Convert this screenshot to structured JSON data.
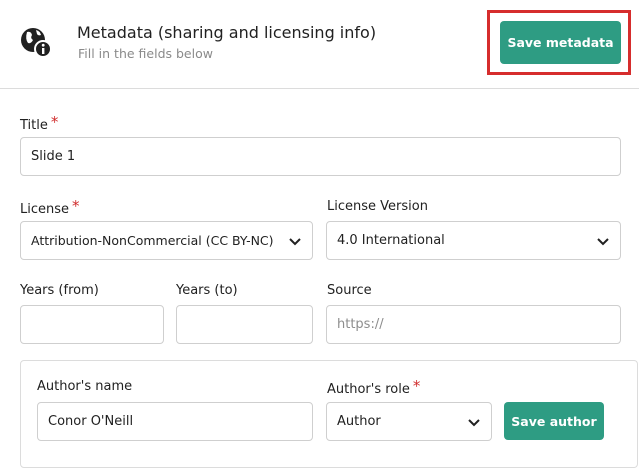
{
  "header": {
    "title": "Metadata (sharing and licensing info)",
    "subtitle": "Fill in the fields below",
    "icon": "globe-info-icon",
    "save_label": "Save metadata"
  },
  "form": {
    "title": {
      "label": "Title",
      "required_mark": "*",
      "value": "Slide 1"
    },
    "license": {
      "label": "License",
      "required_mark": "*",
      "value": "Attribution-NonCommercial (CC BY-NC)"
    },
    "license_version": {
      "label": "License Version",
      "value": "4.0 International"
    },
    "years_from": {
      "label": "Years (from)",
      "value": ""
    },
    "years_to": {
      "label": "Years (to)",
      "value": ""
    },
    "source": {
      "label": "Source",
      "placeholder": "https://",
      "value": ""
    }
  },
  "author": {
    "name_label": "Author's name",
    "name_value": "Conor O'Neill",
    "role_label": "Author's role",
    "role_required_mark": "*",
    "role_value": "Author",
    "save_label": "Save author"
  },
  "colors": {
    "accent": "#2e9c83",
    "required": "#d02c2c",
    "highlight": "#d62d2d"
  }
}
